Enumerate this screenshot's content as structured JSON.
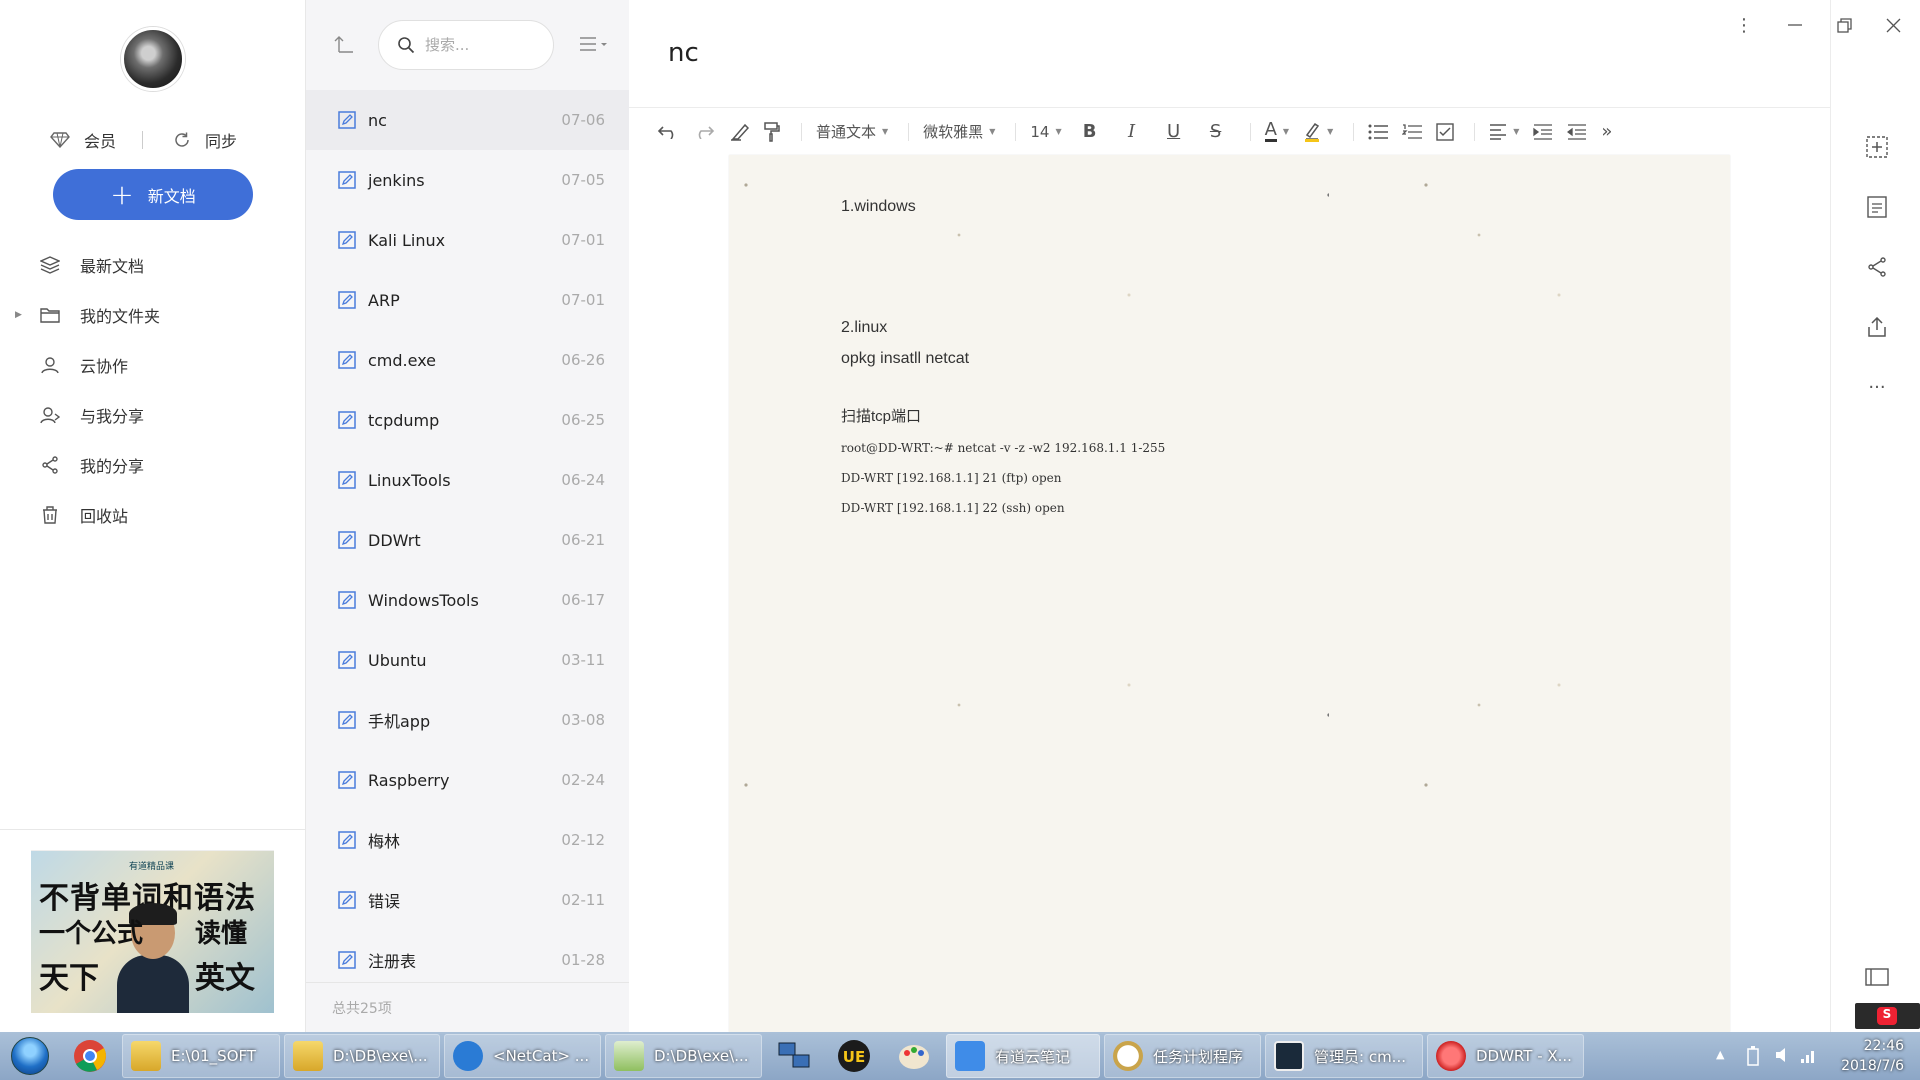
{
  "sidebar": {
    "vip_label": "会员",
    "sync_label": "同步",
    "new_doc_label": "新文档",
    "nav": [
      {
        "label": "最新文档"
      },
      {
        "label": "我的文件夹"
      },
      {
        "label": "云协作"
      },
      {
        "label": "与我分享"
      },
      {
        "label": "我的分享"
      },
      {
        "label": "回收站"
      }
    ],
    "ad": {
      "brand": "有道精品课",
      "line1": "不背单词和语法",
      "line2a": "一个公式",
      "line2b": "读懂",
      "line3a": "天下",
      "line3b": "英文"
    }
  },
  "list": {
    "search_placeholder": "搜索...",
    "notes": [
      {
        "title": "nc",
        "date": "07-06"
      },
      {
        "title": "jenkins",
        "date": "07-05"
      },
      {
        "title": "Kali Linux",
        "date": "07-01"
      },
      {
        "title": "ARP",
        "date": "07-01"
      },
      {
        "title": "cmd.exe",
        "date": "06-26"
      },
      {
        "title": "tcpdump",
        "date": "06-25"
      },
      {
        "title": "LinuxTools",
        "date": "06-24"
      },
      {
        "title": "DDWrt",
        "date": "06-21"
      },
      {
        "title": "WindowsTools",
        "date": "06-17"
      },
      {
        "title": "Ubuntu",
        "date": "03-11"
      },
      {
        "title": "手机app",
        "date": "03-08"
      },
      {
        "title": "Raspberry",
        "date": "02-24"
      },
      {
        "title": "梅林",
        "date": "02-12"
      },
      {
        "title": "错误",
        "date": "02-11"
      },
      {
        "title": "注册表",
        "date": "01-28"
      }
    ],
    "count_label": "总共25项"
  },
  "editor": {
    "title": "nc",
    "toolbar": {
      "paragraph_style": "普通文本",
      "font_family": "微软雅黑",
      "font_size": "14",
      "bold": "B",
      "italic": "I",
      "underline": "U",
      "strike": "S",
      "font_color": "A"
    },
    "lines": [
      "1.windows",
      "2.linux",
      "opkg insatll netcat",
      "扫描tcp端口",
      "root@DD-WRT:~# netcat -v -z -w2 192.168.1.1 1-255",
      "DD-WRT [192.168.1.1] 21 (ftp) open",
      "DD-WRT [192.168.1.1] 22 (ssh) open"
    ]
  },
  "taskbar": {
    "tasks": [
      {
        "label": "E:\\01_SOFT"
      },
      {
        "label": "D:\\DB\\exe\\..."
      },
      {
        "label": "<NetCat> ..."
      },
      {
        "label": "D:\\DB\\exe\\..."
      },
      {
        "label": "有道云笔记"
      },
      {
        "label": "任务计划程序"
      },
      {
        "label": "管理员: cm..."
      },
      {
        "label": "DDWRT - X..."
      }
    ],
    "time": "22:46",
    "date": "2018/7/6"
  },
  "colors": {
    "accent": "#3f6fd8",
    "list_bg": "#f5f5f7",
    "paper_bg": "#f7f5ef"
  }
}
